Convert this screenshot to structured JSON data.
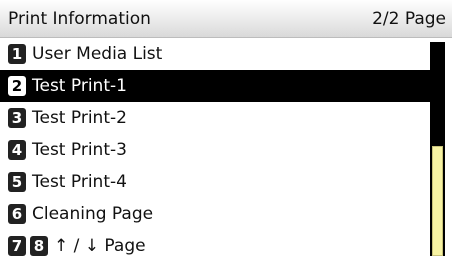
{
  "header": {
    "title": "Print Information",
    "page": "2/2 Page"
  },
  "menu": {
    "items": [
      {
        "number": "1",
        "label": "User Media List"
      },
      {
        "number": "2",
        "label": "Test Print-1"
      },
      {
        "number": "3",
        "label": "Test Print-2"
      },
      {
        "number": "4",
        "label": "Test Print-3"
      },
      {
        "number": "5",
        "label": "Test Print-4"
      },
      {
        "number": "6",
        "label": "Cleaning Page"
      }
    ],
    "selected_index": 1,
    "nav": {
      "prev_number": "7",
      "next_number": "8",
      "label": "↑ / ↓ Page"
    }
  },
  "colors": {
    "selected_bg": "#000000",
    "number_badge": "#222222",
    "scroll_track": "#000000",
    "scroll_thumb": "#f7f3a3"
  },
  "scrollbar": {
    "position": "bottom"
  }
}
